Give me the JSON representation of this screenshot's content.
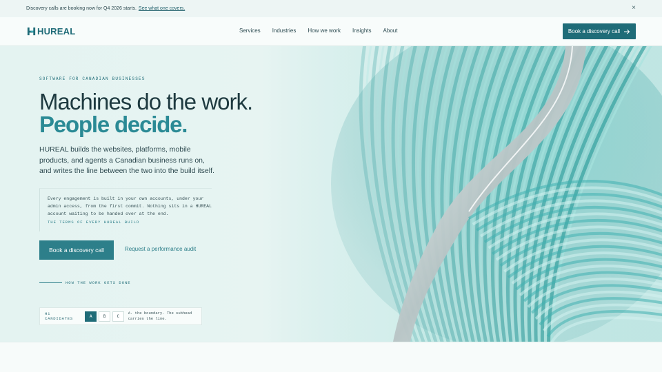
{
  "announcement": {
    "text": "Discovery calls are booking now for Q4 2026 starts.",
    "link": "See what one covers."
  },
  "nav": {
    "logo": "HUREAL",
    "items": [
      "Services",
      "Industries",
      "How we work",
      "Insights",
      "About"
    ],
    "cta": "Book a discovery call"
  },
  "hero": {
    "eyebrow": "SOFTWARE FOR CANADIAN BUSINESSES",
    "headline_line1": "Machines do the work.",
    "headline_line2": "People decide.",
    "lede": "HUREAL builds the websites, platforms, mobile products, and agents a Canadian business runs on, and writes the line between the two into the build itself.",
    "quote": "Every engagement is built in your own accounts, under your admin access, from the first commit. Nothing sits in a HUREAL account waiting to be handed over at the end.",
    "quote_caption": "THE TERMS OF EVERY HUREAL BUILD",
    "primary_cta": "Book a discovery call",
    "secondary_cta": "Request a performance audit",
    "section_link": "HOW THE WORK GETS DONE"
  },
  "candidates": {
    "label": "H1 CANDIDATES",
    "options": [
      "A",
      "B",
      "C"
    ],
    "selected": "A",
    "note": "A. the boundary. The subhead carries the line."
  },
  "colors": {
    "brand": "#1f6c78",
    "accent": "#2a8a95",
    "background": "#e4f3f1"
  },
  "icons": {
    "close": "close-icon",
    "arrow": "arrow-right-icon",
    "logo": "logo-mark-icon"
  }
}
